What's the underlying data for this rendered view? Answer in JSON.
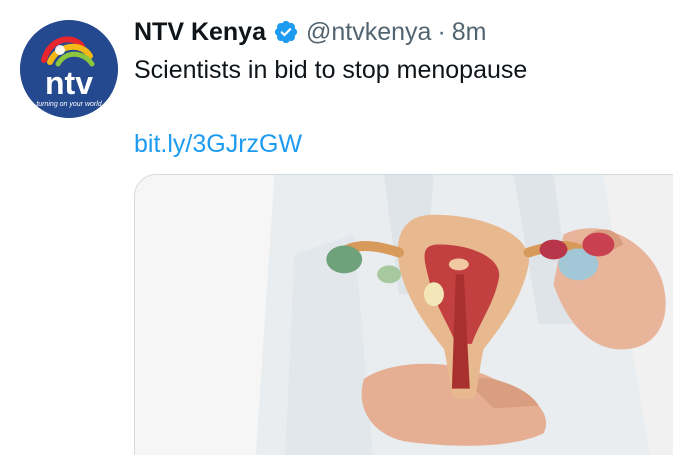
{
  "tweet": {
    "display_name": "NTV Kenya",
    "handle": "@ntvkenya",
    "separator": "·",
    "timestamp": "8m",
    "text": "Scientists in bid to stop menopause",
    "link": "bit.ly/3GJrzGW",
    "avatar": {
      "logo_text": "ntv",
      "tagline": "turning on your world"
    },
    "verified_icon": "verified-badge-icon",
    "media_description_icon": "uterus-anatomical-model-image"
  },
  "colors": {
    "link": "#1d9bf0",
    "verified": "#1d9bf0",
    "text": "#0f1419",
    "secondary_text": "#536471",
    "avatar_bg": "#2a4f9c"
  }
}
